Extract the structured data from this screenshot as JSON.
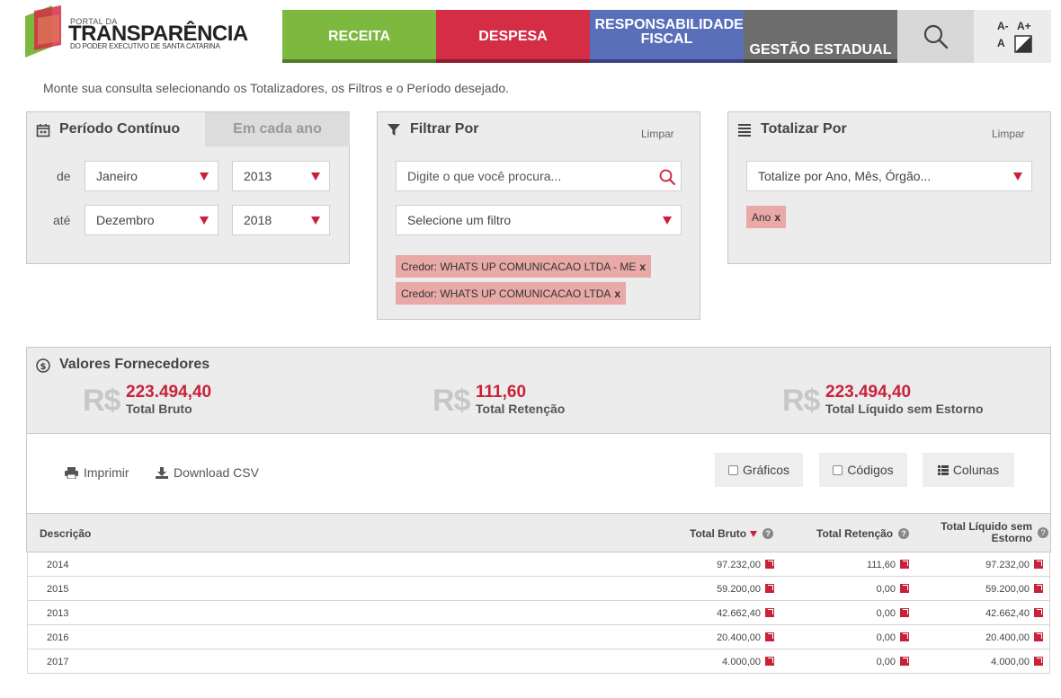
{
  "header": {
    "logo": {
      "small": "PORTAL DA",
      "big": "TRANSPARÊNCIA",
      "sub": "DO PODER EXECUTIVO DE SANTA CATARINA"
    },
    "nav": [
      {
        "label": "RECEITA",
        "color": "#7db83f",
        "bar": "#4e7d25"
      },
      {
        "label": "DESPESA",
        "color": "#d42d45",
        "bar": "#8e1d2e"
      },
      {
        "label": "RESPONSABILIDADE FISCAL",
        "color": "#5a6fba",
        "bar": "#36457f"
      },
      {
        "label": "GESTÃO ESTADUAL",
        "color": "#6d6d6d",
        "bar": "#3c3c3c"
      }
    ],
    "font_controls": {
      "decrease": "A-",
      "increase": "A+",
      "reset": "A"
    }
  },
  "intro": "Monte sua consulta selecionando os Totalizadores, os Filtros e o Período desejado.",
  "periodo": {
    "title": "Período Contínuo",
    "tab_alt": "Em cada ano",
    "de_label": "de",
    "ate_label": "até",
    "de_month": "Janeiro",
    "de_year": "2013",
    "ate_month": "Dezembro",
    "ate_year": "2018"
  },
  "filtrar": {
    "title": "Filtrar Por",
    "limpar": "Limpar",
    "search_placeholder": "Digite o que você procura...",
    "filter_select": "Selecione um filtro",
    "tags": [
      "Credor: WHATS UP COMUNICACAO LTDA - ME",
      "Credor: WHATS UP COMUNICACAO LTDA"
    ]
  },
  "totalizar": {
    "title": "Totalizar Por",
    "limpar": "Limpar",
    "select": "Totalize por Ano, Mês, Órgão...",
    "tags": [
      "Ano"
    ]
  },
  "valores": {
    "title": "Valores Fornecedores",
    "currency": "R$",
    "items": [
      {
        "value": "223.494,40",
        "label": "Total Bruto"
      },
      {
        "value": "111,60",
        "label": "Total Retenção"
      },
      {
        "value": "223.494,40",
        "label": "Total Líquido sem Estorno"
      }
    ]
  },
  "toolbar": {
    "print": "Imprimir",
    "csv": "Download CSV",
    "graficos": "Gráficos",
    "codigos": "Códigos",
    "colunas": "Colunas"
  },
  "table": {
    "headers": {
      "descricao": "Descrição",
      "bruto": "Total Bruto",
      "retencao": "Total Retenção",
      "liquido": "Total Líquido sem Estorno"
    },
    "rows": [
      {
        "descricao": "2014",
        "bruto": "97.232,00",
        "retencao": "111,60",
        "liquido": "97.232,00"
      },
      {
        "descricao": "2015",
        "bruto": "59.200,00",
        "retencao": "0,00",
        "liquido": "59.200,00"
      },
      {
        "descricao": "2013",
        "bruto": "42.662,40",
        "retencao": "0,00",
        "liquido": "42.662,40"
      },
      {
        "descricao": "2016",
        "bruto": "20.400,00",
        "retencao": "0,00",
        "liquido": "20.400,00"
      },
      {
        "descricao": "2017",
        "bruto": "4.000,00",
        "retencao": "0,00",
        "liquido": "4.000,00"
      }
    ]
  },
  "colors": {
    "accent": "#c8213a",
    "panel": "#ececec",
    "tag": "#e8a9a7"
  }
}
